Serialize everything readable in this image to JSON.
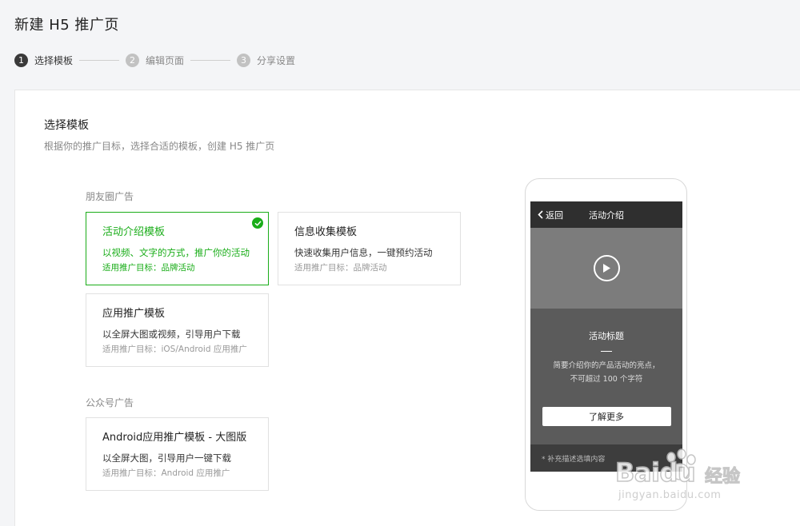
{
  "page": {
    "title": "新建 H5 推广页"
  },
  "steps": [
    {
      "num": "1",
      "label": "选择模板"
    },
    {
      "num": "2",
      "label": "编辑页面"
    },
    {
      "num": "3",
      "label": "分享设置"
    }
  ],
  "panel": {
    "title": "选择模板",
    "desc": "根据你的推广目标，选择合适的模板，创建 H5 推广页"
  },
  "groups": [
    {
      "label": "朋友圈广告",
      "cards": [
        {
          "title": "活动介绍模板",
          "desc": "以视频、文字的方式，推广你的活动",
          "meta": "适用推广目标：品牌活动",
          "selected": true
        },
        {
          "title": "信息收集模板",
          "desc": "快速收集用户信息，一键预约活动",
          "meta": "适用推广目标：品牌活动",
          "selected": false
        },
        {
          "title": "应用推广模板",
          "desc": "以全屏大图或视频，引导用户下载",
          "meta": "适用推广目标：iOS/Android 应用推广",
          "selected": false
        }
      ]
    },
    {
      "label": "公众号广告",
      "cards": [
        {
          "title": "Android应用推广模板 - 大图版",
          "desc": "以全屏大图，引导用户一键下载",
          "meta": "适用推广目标：Android 应用推广",
          "selected": false
        }
      ]
    }
  ],
  "preview": {
    "back_label": "返回",
    "nav_title": "活动介绍",
    "activity_title": "活动标题",
    "desc_line1": "简要介绍你的产品活动的亮点，",
    "desc_line2": "不可超过 100 个字符",
    "button_label": "了解更多",
    "footnote": "* 补充描述选填内容"
  },
  "watermark": {
    "brand": "Baidu",
    "cn": "经验",
    "url": "jingyan.baidu.com"
  },
  "colors": {
    "accent": "#1aad19",
    "step_active": "#3a3a3a",
    "step_inactive": "#c2c2c2"
  }
}
